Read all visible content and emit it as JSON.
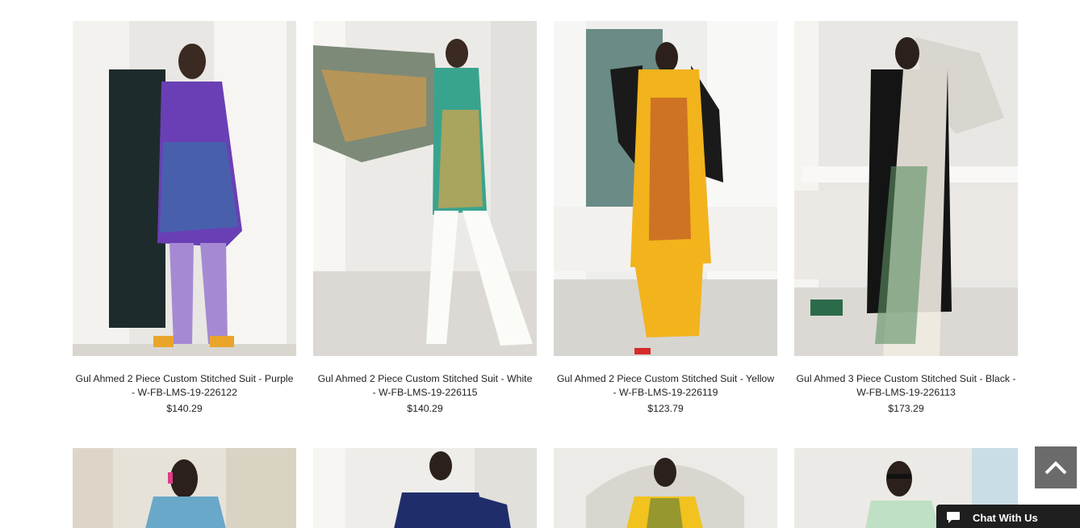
{
  "products_row1": [
    {
      "title": "Gul Ahmed 2 Piece Custom Stitched Suit - Purple - W-FB-LMS-19-226122",
      "price": "$140.29",
      "image": "model-purple-suit"
    },
    {
      "title": "Gul Ahmed 2 Piece Custom Stitched Suit - White - W-FB-LMS-19-226115",
      "price": "$140.29",
      "image": "model-green-white-suit"
    },
    {
      "title": "Gul Ahmed 2 Piece Custom Stitched Suit - Yellow - W-FB-LMS-19-226119",
      "price": "$123.79",
      "image": "model-yellow-suit"
    },
    {
      "title": "Gul Ahmed 3 Piece Custom Stitched Suit - Black - W-FB-LMS-19-226113",
      "price": "$173.29",
      "image": "model-black-suit"
    }
  ],
  "products_row2": [
    {
      "image": "model-blue-suit"
    },
    {
      "image": "model-navy-suit"
    },
    {
      "image": "model-yellow-print-suit"
    },
    {
      "image": "model-mint-suit"
    }
  ],
  "chat": {
    "label": "Chat With Us"
  },
  "icons": {
    "scroll_top": "chevron-up-icon",
    "chat": "chat-bubble-icon"
  },
  "colors": {
    "scroll_top_bg": "#6b6b6b",
    "chat_bg": "#1f1f1f"
  }
}
